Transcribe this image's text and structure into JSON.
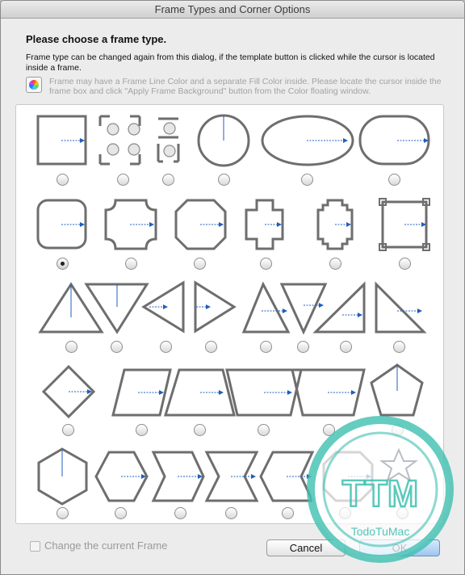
{
  "window": {
    "title": "Frame Types and Corner Options"
  },
  "heading": "Please choose a frame type.",
  "description": "Frame type can be changed again from this dialog, if the template button is clicked while the cursor is located inside a frame.",
  "color_hint": "Frame may have a Frame Line Color and a separate Fill Color inside. Please locate the cursor inside the frame box and click \"Apply Frame Background\" button from the Color floating window.",
  "frame_types": [
    [
      "rectangle",
      "split-corners",
      "split-small",
      "circle",
      "ellipse",
      "capsule"
    ],
    [
      "rounded-rect",
      "concave-corners",
      "octagon",
      "cross",
      "stepped",
      "notched"
    ],
    [
      "triangle-up",
      "triangle-down",
      "triangle-left",
      "triangle-right",
      "triangle-up-2",
      "triangle-down-2",
      "right-triangle-a",
      "right-triangle-b"
    ],
    [
      "diamond",
      "parallelogram",
      "trapezoid",
      "trapezoid-inverted",
      "parallelogram-reverse",
      "pentagon"
    ],
    [
      "hexagon-vertical",
      "hexagon-horizontal",
      "chevron",
      "hourglass",
      "chevron-reverse",
      "octagon-2",
      "blank"
    ]
  ],
  "selected_frame": "rounded-rect",
  "checkbox": {
    "label": "Change the current Frame",
    "checked": false
  },
  "buttons": {
    "cancel": "Cancel",
    "ok": "OK"
  },
  "watermark": {
    "letters": "TTM",
    "caption": "TodoTuMac"
  },
  "colors": {
    "frame_stroke": "#6e6e6e",
    "pointer": "#1f5fbf",
    "watermark": "#3fbfb0"
  }
}
